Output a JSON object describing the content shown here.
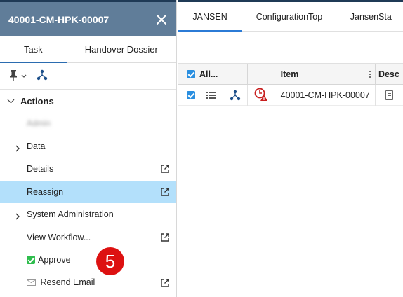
{
  "panel": {
    "title": "40001-CM-HPK-00007",
    "tabs": [
      {
        "label": "Task",
        "active": true
      },
      {
        "label": "Handover Dossier",
        "active": false
      }
    ],
    "toolbar": {
      "pin_icon": "pin-icon",
      "workflow_icon": "workflow-icon"
    },
    "actions_header": "Actions",
    "items": [
      {
        "label": "Admin",
        "obscured": true
      },
      {
        "label": "Data",
        "expandable": true
      },
      {
        "label": "Details",
        "external": true
      },
      {
        "label": "Reassign",
        "external": true,
        "selected": true
      },
      {
        "label": "System Administration",
        "expandable": true
      },
      {
        "label": "View Workflow...",
        "external": true
      },
      {
        "label": "Approve",
        "icon": "check-icon"
      },
      {
        "label": "Resend Email",
        "icon": "mail-icon",
        "external": true
      }
    ],
    "step_badge": "5"
  },
  "main": {
    "tabs": [
      {
        "label": "JANSEN",
        "active": true
      },
      {
        "label": "ConfigurationTop",
        "active": false
      },
      {
        "label": "JansenSta",
        "active": false
      }
    ],
    "grid": {
      "headers": {
        "select_all": "All...",
        "item": "Item",
        "desc": "Desc"
      },
      "rows": [
        {
          "item": "40001-CM-HPK-00007",
          "checked": true
        }
      ]
    }
  },
  "colors": {
    "header_bg": "#607d99",
    "selected_row": "#b3e0fb",
    "badge": "#dd1111",
    "accent": "#2a8fe0"
  }
}
